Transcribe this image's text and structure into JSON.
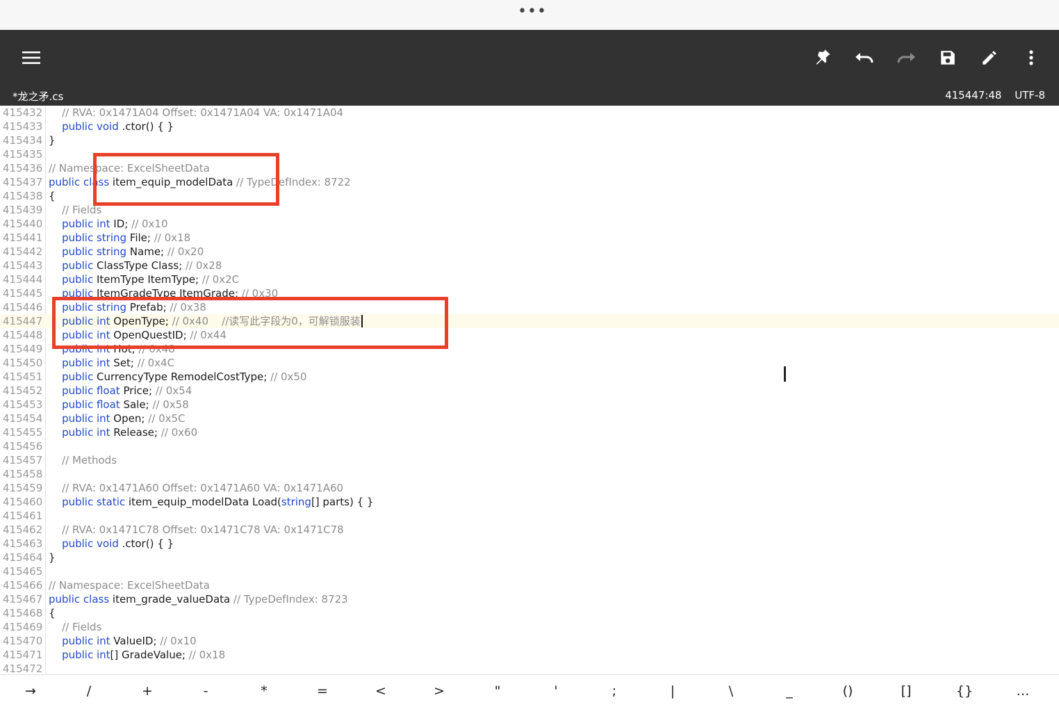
{
  "window": {
    "handle": "•••"
  },
  "toolbar": {
    "icons": [
      "menu-icon",
      "pin-icon",
      "undo-icon",
      "redo-icon",
      "save-icon",
      "edit-icon",
      "more-vert-icon"
    ]
  },
  "status": {
    "filename": "*龙之矛.cs",
    "position": "415447:48",
    "encoding": "UTF-8"
  },
  "editor": {
    "active_line": "415447",
    "lines": [
      {
        "n": "415432",
        "t": [
          [
            "cm",
            "    // RVA: 0x1471A04 Offset: 0x1471A04 VA: 0x1471A04"
          ]
        ]
      },
      {
        "n": "415433",
        "t": [
          [
            "kw",
            "    public void"
          ],
          [
            "tx",
            " .ctor() { }"
          ]
        ]
      },
      {
        "n": "415434",
        "t": [
          [
            "tx",
            "}"
          ]
        ]
      },
      {
        "n": "415435",
        "t": []
      },
      {
        "n": "415436",
        "t": [
          [
            "cm",
            "// Namespace: ExcelSheetData"
          ]
        ]
      },
      {
        "n": "415437",
        "t": [
          [
            "kw",
            "public class"
          ],
          [
            "tx",
            " item_equip_modelData "
          ],
          [
            "cm",
            "// TypeDefIndex: 8722"
          ]
        ]
      },
      {
        "n": "415438",
        "t": [
          [
            "tx",
            "{"
          ]
        ]
      },
      {
        "n": "415439",
        "t": [
          [
            "cm",
            "    // Fields"
          ]
        ]
      },
      {
        "n": "415440",
        "t": [
          [
            "kw",
            "    public int"
          ],
          [
            "tx",
            " ID; "
          ],
          [
            "cm",
            "// 0x10"
          ]
        ]
      },
      {
        "n": "415441",
        "t": [
          [
            "kw",
            "    public string"
          ],
          [
            "tx",
            " File; "
          ],
          [
            "cm",
            "// 0x18"
          ]
        ]
      },
      {
        "n": "415442",
        "t": [
          [
            "kw",
            "    public string"
          ],
          [
            "tx",
            " Name; "
          ],
          [
            "cm",
            "// 0x20"
          ]
        ]
      },
      {
        "n": "415443",
        "t": [
          [
            "kw",
            "    public"
          ],
          [
            "tx",
            " ClassType Class; "
          ],
          [
            "cm",
            "// 0x28"
          ]
        ]
      },
      {
        "n": "415444",
        "t": [
          [
            "kw",
            "    public"
          ],
          [
            "tx",
            " ItemType ItemType; "
          ],
          [
            "cm",
            "// 0x2C"
          ]
        ]
      },
      {
        "n": "415445",
        "t": [
          [
            "kw",
            "    public"
          ],
          [
            "tx",
            " ItemGradeType ItemGrade; "
          ],
          [
            "cm",
            "// 0x30"
          ]
        ]
      },
      {
        "n": "415446",
        "t": [
          [
            "kw",
            "    public string"
          ],
          [
            "tx",
            " Prefab; "
          ],
          [
            "cm",
            "// 0x38"
          ]
        ]
      },
      {
        "n": "415447",
        "t": [
          [
            "kw",
            "    public int"
          ],
          [
            "tx",
            " OpenType; "
          ],
          [
            "cm",
            "// 0x40    //读写此字段为0，可解锁服装"
          ]
        ]
      },
      {
        "n": "415448",
        "t": [
          [
            "kw",
            "    public int"
          ],
          [
            "tx",
            " OpenQuestID; "
          ],
          [
            "cm",
            "// 0x44"
          ]
        ]
      },
      {
        "n": "415449",
        "t": [
          [
            "kw",
            "    public int"
          ],
          [
            "tx",
            " Hot; "
          ],
          [
            "cm",
            "// 0x48"
          ]
        ]
      },
      {
        "n": "415450",
        "t": [
          [
            "kw",
            "    public int"
          ],
          [
            "tx",
            " Set; "
          ],
          [
            "cm",
            "// 0x4C"
          ]
        ]
      },
      {
        "n": "415451",
        "t": [
          [
            "kw",
            "    public"
          ],
          [
            "tx",
            " CurrencyType RemodelCostType; "
          ],
          [
            "cm",
            "// 0x50"
          ]
        ]
      },
      {
        "n": "415452",
        "t": [
          [
            "kw",
            "    public float"
          ],
          [
            "tx",
            " Price; "
          ],
          [
            "cm",
            "// 0x54"
          ]
        ]
      },
      {
        "n": "415453",
        "t": [
          [
            "kw",
            "    public float"
          ],
          [
            "tx",
            " Sale; "
          ],
          [
            "cm",
            "// 0x58"
          ]
        ]
      },
      {
        "n": "415454",
        "t": [
          [
            "kw",
            "    public int"
          ],
          [
            "tx",
            " Open; "
          ],
          [
            "cm",
            "// 0x5C"
          ]
        ]
      },
      {
        "n": "415455",
        "t": [
          [
            "kw",
            "    public int"
          ],
          [
            "tx",
            " Release; "
          ],
          [
            "cm",
            "// 0x60"
          ]
        ]
      },
      {
        "n": "415456",
        "t": []
      },
      {
        "n": "415457",
        "t": [
          [
            "cm",
            "    // Methods"
          ]
        ]
      },
      {
        "n": "415458",
        "t": []
      },
      {
        "n": "415459",
        "t": [
          [
            "cm",
            "    // RVA: 0x1471A60 Offset: 0x1471A60 VA: 0x1471A60"
          ]
        ]
      },
      {
        "n": "415460",
        "t": [
          [
            "kw",
            "    public static"
          ],
          [
            "tx",
            " item_equip_modelData Load("
          ],
          [
            "kw",
            "string"
          ],
          [
            "tx",
            "[] parts) { }"
          ]
        ]
      },
      {
        "n": "415461",
        "t": []
      },
      {
        "n": "415462",
        "t": [
          [
            "cm",
            "    // RVA: 0x1471C78 Offset: 0x1471C78 VA: 0x1471C78"
          ]
        ]
      },
      {
        "n": "415463",
        "t": [
          [
            "kw",
            "    public void"
          ],
          [
            "tx",
            " .ctor() { }"
          ]
        ]
      },
      {
        "n": "415464",
        "t": [
          [
            "tx",
            "}"
          ]
        ]
      },
      {
        "n": "415465",
        "t": []
      },
      {
        "n": "415466",
        "t": [
          [
            "cm",
            "// Namespace: ExcelSheetData"
          ]
        ]
      },
      {
        "n": "415467",
        "t": [
          [
            "kw",
            "public class"
          ],
          [
            "tx",
            " item_grade_valueData "
          ],
          [
            "cm",
            "// TypeDefIndex: 8723"
          ]
        ]
      },
      {
        "n": "415468",
        "t": [
          [
            "tx",
            "{"
          ]
        ]
      },
      {
        "n": "415469",
        "t": [
          [
            "cm",
            "    // Fields"
          ]
        ]
      },
      {
        "n": "415470",
        "t": [
          [
            "kw",
            "    public int"
          ],
          [
            "tx",
            " ValueID; "
          ],
          [
            "cm",
            "// 0x10"
          ]
        ]
      },
      {
        "n": "415471",
        "t": [
          [
            "kw",
            "    public int"
          ],
          [
            "tx",
            "[] GradeValue; "
          ],
          [
            "cm",
            "// 0x18"
          ]
        ]
      },
      {
        "n": "415472",
        "t": []
      }
    ]
  },
  "keybar": {
    "keys": [
      "→",
      "/",
      "+",
      "-",
      "*",
      "=",
      "<",
      ">",
      "\"",
      "'",
      ";",
      "|",
      "\\",
      "_",
      "()",
      "[]",
      "{}",
      "…"
    ]
  },
  "colors": {
    "toolbar_bg": "#323232",
    "keyword": "#2348c7",
    "comment": "#8c8c8c",
    "highlight_box": "#e8402a"
  }
}
